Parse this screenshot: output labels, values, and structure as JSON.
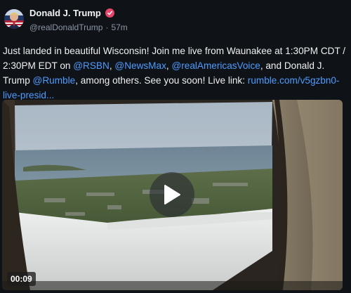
{
  "author": {
    "name": "Donald J. Trump",
    "handle": "@realDonaldTrump",
    "separator": "·",
    "time_ago": "57m"
  },
  "post": {
    "text_1": "Just landed in beautiful Wisconsin! Join me live from Waunakee at 1:30PM CDT / 2:30PM EDT on ",
    "mention_rsbn": "@RSBN",
    "comma_1": ", ",
    "mention_newsmax": "@NewsMax",
    "comma_2": ", ",
    "mention_ramericas": "@realAmericasVoice",
    "text_2": ", and Donald J. Trump ",
    "mention_rumble": "@Rumble",
    "text_3": ", among others. See you soon! Live link: ",
    "link": "rumble.com/v5gzbn0-live-presid..."
  },
  "video": {
    "duration": "00:09"
  },
  "icons": {
    "avatar": "avatar-image",
    "verified": "verified-badge-icon",
    "play": "play-icon"
  },
  "colors": {
    "background": "#0f1217",
    "link": "#4d9cff",
    "verified": "#e8456b"
  }
}
